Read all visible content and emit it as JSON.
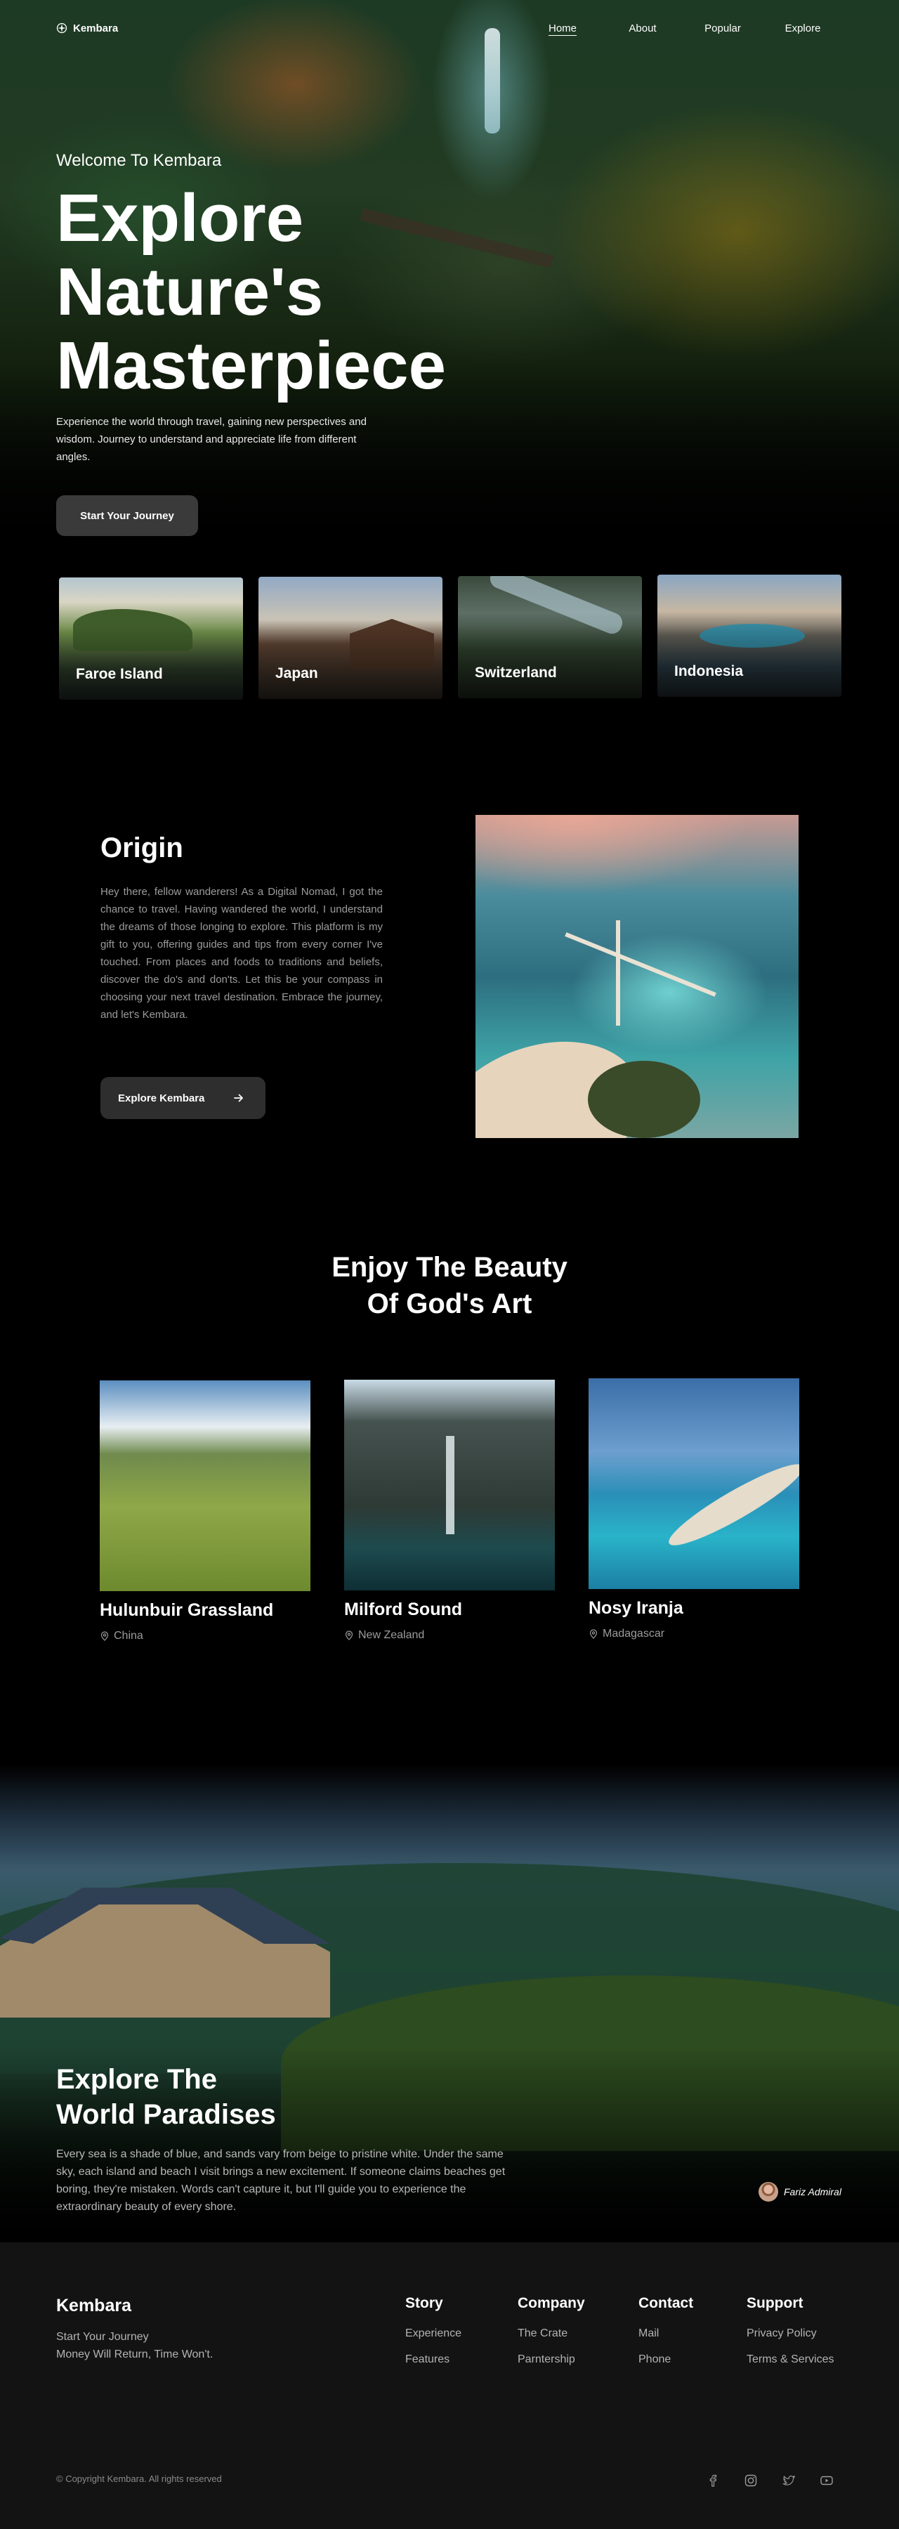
{
  "nav": {
    "brand": "Kembara",
    "links": [
      "Home",
      "About",
      "Popular",
      "Explore"
    ],
    "active": "Home"
  },
  "hero": {
    "welcome": "Welcome To Kembara",
    "title_lines": [
      "Explore",
      "Nature's",
      "Masterpiece"
    ],
    "description": "Experience the world through travel, gaining new perspectives and wisdom. Journey to understand and appreciate life from different angles.",
    "button": "Start Your Journey"
  },
  "destinations": [
    "Faroe Island",
    "Japan",
    "Switzerland",
    "Indonesia"
  ],
  "origin": {
    "title": "Origin",
    "text": "Hey there, fellow wanderers! As a Digital Nomad, I got the chance to travel. Having wandered the world, I understand the dreams of those longing to explore. This platform is my gift to you, offering guides and tips from every corner I've touched. From places and foods to traditions and beliefs, discover the do's and don'ts. Let this be your compass in choosing your next travel destination. Embrace the journey, and let's Kembara.",
    "button": "Explore Kembara"
  },
  "beauty": {
    "title_lines": [
      "Enjoy The Beauty",
      "Of God's Art"
    ],
    "places": [
      {
        "name": "Hulunbuir Grassland",
        "location": "China"
      },
      {
        "name": "Milford Sound",
        "location": "New Zealand"
      },
      {
        "name": "Nosy Iranja",
        "location": "Madagascar"
      }
    ]
  },
  "paradise": {
    "title_lines": [
      "Explore The",
      "World Paradises"
    ],
    "text": "Every sea is a shade of blue, and sands vary from beige to pristine white. Under the same sky, each island and beach I visit brings a new excitement. If someone claims beaches get boring, they're mistaken. Words can't capture it, but I'll guide you to experience the extraordinary beauty of every shore.",
    "author": "Fariz Admiral"
  },
  "footer": {
    "brand": "Kembara",
    "tagline_lines": [
      "Start Your Journey",
      "Money Will Return, Time Won't."
    ],
    "columns": [
      {
        "title": "Story",
        "links": [
          "Experience",
          "Features"
        ]
      },
      {
        "title": "Company",
        "links": [
          "The Crate",
          "Parntership"
        ]
      },
      {
        "title": "Contact",
        "links": [
          "Mail",
          "Phone"
        ]
      },
      {
        "title": "Support",
        "links": [
          "Privacy Policy",
          "Terms & Services"
        ]
      }
    ],
    "copyright": "© Copyright Kembara. All rights reserved",
    "social_icons": [
      "facebook-icon",
      "instagram-icon",
      "twitter-icon",
      "youtube-icon"
    ]
  },
  "colors": {
    "background": "#000000",
    "footer": "#131313",
    "button": "#3a3a3a",
    "muted_text": "#9c9c9c"
  }
}
